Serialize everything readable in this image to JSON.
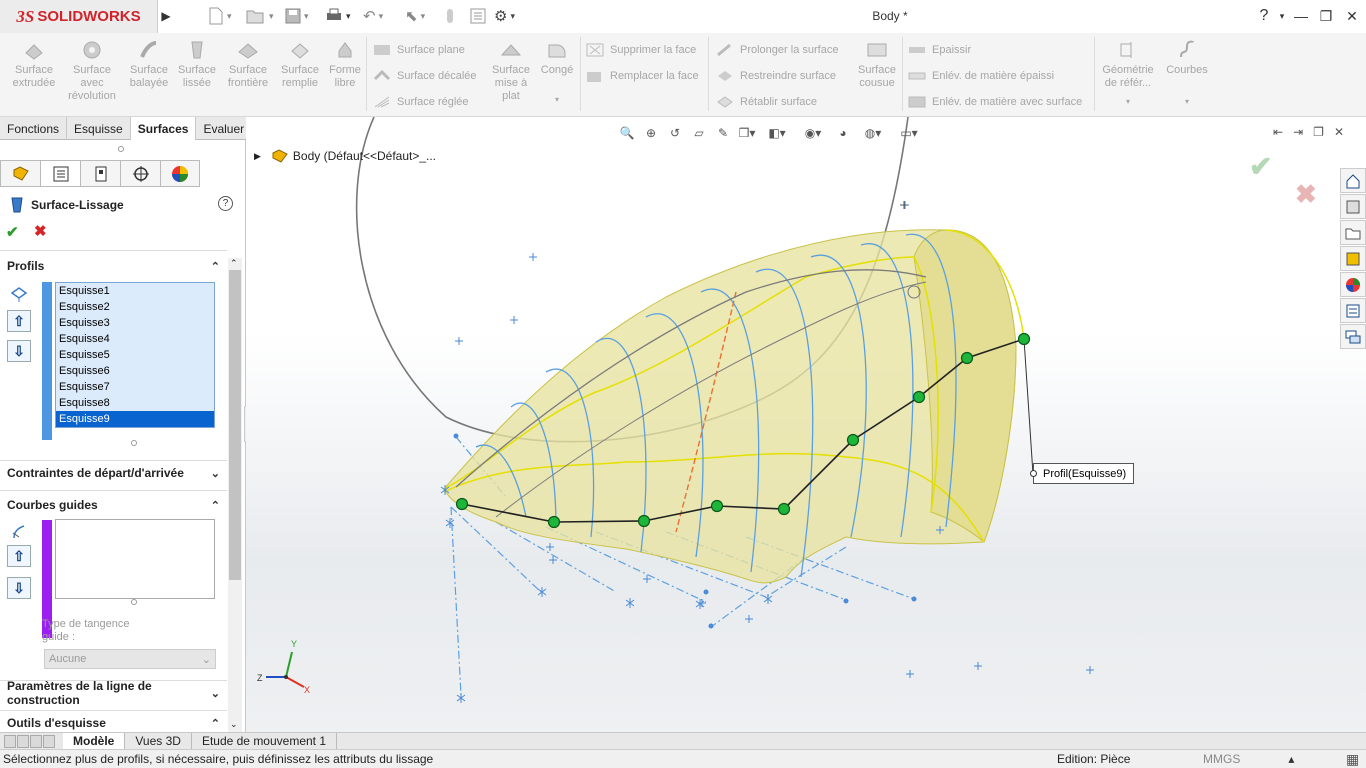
{
  "app": {
    "logo_ds": "3S",
    "logo_text": "SOLIDWORKS",
    "doc_title": "Body *"
  },
  "window": {
    "help": "?",
    "help_arrow": "▾",
    "minimize": "—",
    "restore": "❐",
    "close": "✕"
  },
  "ribbon": {
    "big_buttons": [
      {
        "label": "Surface\nextrudée"
      },
      {
        "label": "Surface\navec\nrévolution"
      },
      {
        "label": "Surface\nbalayée"
      },
      {
        "label": "Surface\nlissée"
      },
      {
        "label": "Surface\nfrontière"
      },
      {
        "label": "Surface\nremplie"
      },
      {
        "label": "Forme\nlibre"
      }
    ],
    "col1": [
      "Surface plane",
      "Surface décalée",
      "Surface réglée"
    ],
    "mise_a_plat": "Surface\nmise à\nplat",
    "conge": "Congé",
    "col2": [
      "Supprimer la face",
      "Remplacer la face"
    ],
    "col3": [
      "Prolonger la surface",
      "Restreindre surface",
      "Rétablir surface"
    ],
    "cousue": "Surface\ncousue",
    "col4": [
      "Epaissir",
      "Enlév. de matière épaissi",
      "Enlév. de matière avec surface"
    ],
    "geometrie": "Géométrie\nde référ...",
    "courbes": "Courbes"
  },
  "command_tabs": [
    "Fonctions",
    "Esquisse",
    "Surfaces",
    "Evaluer"
  ],
  "property_manager": {
    "title": "Surface-Lissage",
    "help": "?",
    "ok": "✔",
    "cancel": "✖",
    "profils_header": "Profils",
    "profiles": [
      "Esquisse1",
      "Esquisse2",
      "Esquisse3",
      "Esquisse4",
      "Esquisse5",
      "Esquisse6",
      "Esquisse7",
      "Esquisse8",
      "Esquisse9"
    ],
    "selected_profile": "Esquisse9",
    "contraintes_header": "Contraintes de départ/d'arrivée",
    "courbes_header": "Courbes guides",
    "tangence_label": "Type de tangence\nguide :",
    "tangence_value": "Aucune",
    "parametres_header": "Paramètres de la ligne de construction",
    "outils_header": "Outils d'esquisse"
  },
  "viewport": {
    "tree_item": "Body  (Défaut<<Défaut>_...",
    "profil_tag": "Profil(Esquisse9)",
    "triad": {
      "x": "X",
      "y": "Y",
      "z": "Z"
    }
  },
  "bottom_tabs": [
    "Modèle",
    "Vues 3D",
    "Etude de mouvement 1"
  ],
  "status": {
    "message": "Sélectionnez plus de profils, si nécessaire, puis définissez les attributs du lissage",
    "mode": "Edition: Pièce",
    "units": "MMGS",
    "units_arrow": "▴"
  },
  "colors": {
    "accent_blue": "#0a64d0",
    "profile_bar": "#4e97e2",
    "guide_bar": "#9a1ff0",
    "surface": "#e8e3a0",
    "brand_red": "#d2232a"
  }
}
